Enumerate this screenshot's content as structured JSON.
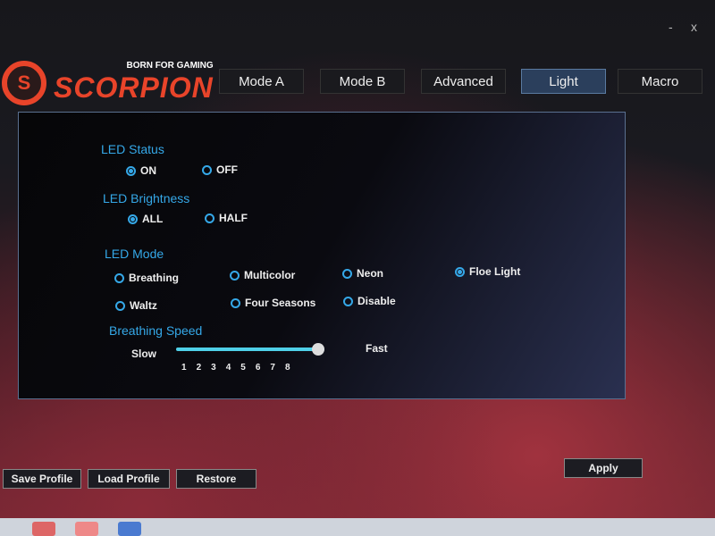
{
  "window": {
    "minimize": "-",
    "close": "x"
  },
  "logo": {
    "tagline": "BORN FOR GAMING",
    "name": "SCORPION"
  },
  "tabs": [
    {
      "label": "Mode A",
      "active": false
    },
    {
      "label": "Mode B",
      "active": false
    },
    {
      "label": "Advanced",
      "active": false
    },
    {
      "label": "Light",
      "active": true
    },
    {
      "label": "Macro",
      "active": false
    }
  ],
  "led_status": {
    "title": "LED Status",
    "options": [
      {
        "label": "ON",
        "selected": true
      },
      {
        "label": "OFF",
        "selected": false
      }
    ]
  },
  "led_brightness": {
    "title": "LED Brightness",
    "options": [
      {
        "label": "ALL",
        "selected": true
      },
      {
        "label": "HALF",
        "selected": false
      }
    ]
  },
  "led_mode": {
    "title": "LED Mode",
    "options": [
      {
        "label": "Breathing",
        "selected": false
      },
      {
        "label": "Multicolor",
        "selected": false
      },
      {
        "label": "Neon",
        "selected": false
      },
      {
        "label": "Floe Light",
        "selected": true
      },
      {
        "label": "Waltz",
        "selected": false
      },
      {
        "label": "Four Seasons",
        "selected": false
      },
      {
        "label": "Disable",
        "selected": false
      }
    ]
  },
  "breathing_speed": {
    "title": "Breathing Speed",
    "slow": "Slow",
    "fast": "Fast",
    "ticks": [
      "1",
      "2",
      "3",
      "4",
      "5",
      "6",
      "7",
      "8"
    ],
    "value": 8,
    "min": 1,
    "max": 8
  },
  "buttons": {
    "save": "Save Profile",
    "load": "Load Profile",
    "restore": "Restore",
    "apply": "Apply"
  },
  "colors": {
    "accent": "#35a8e8",
    "brand": "#e8442a"
  }
}
